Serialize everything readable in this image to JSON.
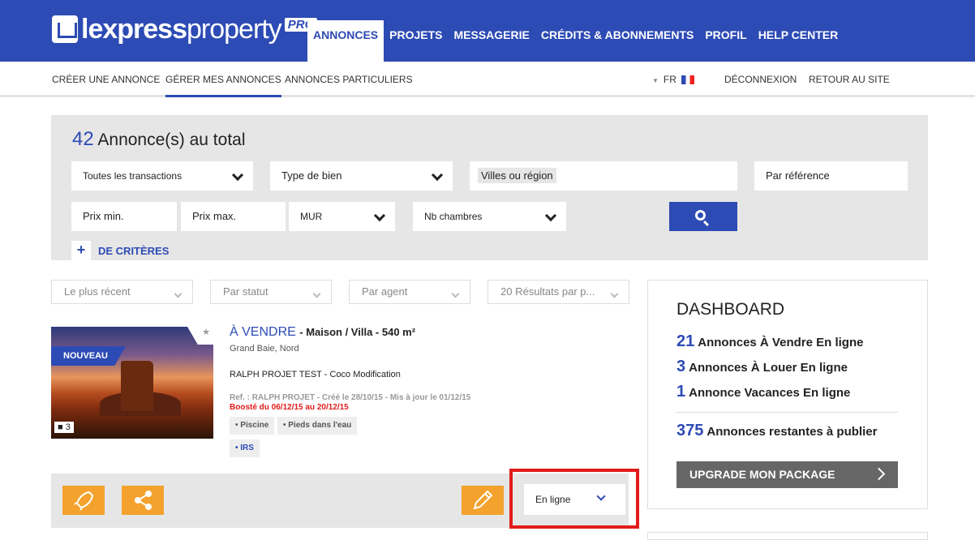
{
  "logo": {
    "text_bold": "lexpress",
    "text_light": "property",
    "badge": "PRO"
  },
  "main_nav": [
    "ANNONCES",
    "PROJETS",
    "MESSAGERIE",
    "CRÉDITS & ABONNEMENTS",
    "PROFIL",
    "HELP CENTER"
  ],
  "sub_nav": {
    "create": "CRÉER UNE ANNONCE",
    "manage": "GÉRER MES ANNONCES",
    "private": "ANNONCES PARTICULIERS",
    "lang": "FR",
    "logout": "DÉCONNEXION",
    "back": "RETOUR AU SITE"
  },
  "search": {
    "total_count": "42",
    "total_label": "Annonce(s) au total",
    "transactions": "Toutes les transactions",
    "property_type": "Type de bien",
    "location_placeholder": "Villes ou région",
    "reference_placeholder": "Par référence",
    "price_min": "Prix min.",
    "price_max": "Prix max.",
    "currency": "MUR",
    "bedrooms": "Nb chambres",
    "more_criteria": "DE CRITÈRES"
  },
  "filters": {
    "sort": "Le plus récent",
    "status": "Par statut",
    "agent": "Par agent",
    "per_page": "20 Résultats par p..."
  },
  "listing": {
    "badge": "NOUVEAU",
    "photo_count": "3",
    "type": "À VENDRE",
    "details": "- Maison / Villa - 540 m²",
    "location": "Grand Baie, Nord",
    "project": "RALPH PROJET TEST - Coco Modification",
    "meta": "Ref. : RALPH PROJET - Créé le 28/10/15 - Mis à jour le 01/12/15",
    "boosted": "Boosté du 06/12/15 au 20/12/15",
    "tags": [
      "• Piscine",
      "• Pieds dans l'eau"
    ],
    "tag_irs": "• IRS",
    "status": "En ligne"
  },
  "dashboard": {
    "title": "DASHBOARD",
    "stats": [
      {
        "num": "21",
        "label": "Annonces À Vendre En ligne"
      },
      {
        "num": "3",
        "label": "Annonces À Louer En ligne"
      },
      {
        "num": "1",
        "label": "Annonce Vacances En ligne"
      }
    ],
    "remaining_num": "375",
    "remaining_label": "Annonces restantes à publier",
    "upgrade": "UPGRADE MON PACKAGE"
  },
  "colors": {
    "primary": "#2d4bb4",
    "accent": "#f4a22d",
    "highlight": "#e31b1b"
  }
}
